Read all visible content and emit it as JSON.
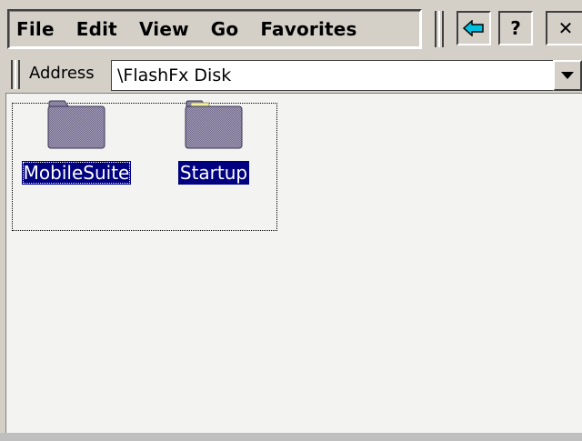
{
  "menu": {
    "items": [
      "File",
      "Edit",
      "View",
      "Go",
      "Favorites"
    ]
  },
  "toolbar": {
    "back_icon": "back-arrow-icon",
    "help_label": "?",
    "close_label": "✕",
    "accent_color": "#00c0e0"
  },
  "address": {
    "label": "Address",
    "value": "\\FlashFx Disk"
  },
  "folders": [
    {
      "name": "MobileSuite",
      "icon": "folder-icon",
      "selected": true
    },
    {
      "name": "Startup",
      "icon": "folder-icon",
      "selected": true
    }
  ],
  "colors": {
    "selection": "#000080",
    "content_bg": "#f3f4f1",
    "chrome": "#d4d0c8"
  }
}
